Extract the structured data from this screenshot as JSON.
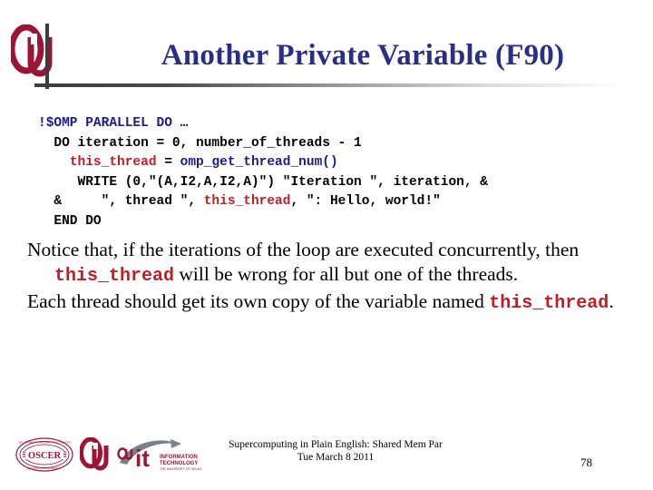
{
  "slide": {
    "title": "Another Private Variable (F90)",
    "title_color": "#2a2f86",
    "accent_crimson": "#9d1535",
    "code_blue": "#1b1b8f",
    "code_red": "#c21d24"
  },
  "header": {
    "logo_name": "ou-logo",
    "rule_name": "header-gradient-rule"
  },
  "code": {
    "lines": [
      {
        "name": "code-line-omp-directive",
        "segments": [
          {
            "text": "!$OMP PARALLEL DO ",
            "color": "blue"
          },
          {
            "text": "…",
            "color": "blue"
          }
        ]
      },
      {
        "name": "code-line-do-iteration",
        "segments": [
          {
            "text": "  DO iteration = 0, number_of_threads - 1",
            "color": "black"
          }
        ]
      },
      {
        "name": "code-line-assign-this-thread",
        "segments": [
          {
            "text": "    ",
            "color": "black"
          },
          {
            "text": "this_thread",
            "color": "red"
          },
          {
            "text": " = ",
            "color": "black"
          },
          {
            "text": "omp_get_thread_num()",
            "color": "blue"
          }
        ]
      },
      {
        "name": "code-line-write",
        "segments": [
          {
            "text": "     WRITE (0,\"(A,I2,A,I2,A)\") \"Iteration \", iteration, &",
            "color": "black"
          }
        ]
      },
      {
        "name": "code-line-write-continuation",
        "segments": [
          {
            "text": "  &     \", thread \", ",
            "color": "black"
          },
          {
            "text": "this_thread",
            "color": "red"
          },
          {
            "text": ", \": Hello, world!\"",
            "color": "black"
          }
        ]
      },
      {
        "name": "code-line-end-do",
        "segments": [
          {
            "text": "  END DO",
            "color": "black"
          }
        ]
      }
    ]
  },
  "body": {
    "paragraphs": [
      {
        "name": "body-paragraph-notice",
        "segments": [
          {
            "text": "Notice that, if the iterations of the loop are executed concurrently, then ",
            "style": "normal"
          },
          {
            "text": "this_thread",
            "style": "mono-red"
          },
          {
            "text": " will be wrong for all but one of the threads.",
            "style": "normal"
          }
        ]
      },
      {
        "name": "body-paragraph-each-thread",
        "segments": [
          {
            "text": "Each thread should get its own copy of the  variable named ",
            "style": "normal"
          },
          {
            "text": "this_thread",
            "style": "mono-red"
          },
          {
            "text": ".",
            "style": "normal"
          }
        ]
      }
    ]
  },
  "footer": {
    "line1": "Supercomputing in Plain English: Shared Mem Par",
    "line2": "Tue March 8 2011",
    "page_number": "78",
    "logos": [
      {
        "name": "oscer-logo",
        "label": "OSCER"
      },
      {
        "name": "ou-logo-footer",
        "label": "OU"
      },
      {
        "name": "ou-it-logo",
        "label": "it"
      }
    ],
    "it_logo_text": {
      "mark": "it",
      "line1": "INFORMATION",
      "line2": "TECHNOLOGY",
      "line3": "THE UNIVERSITY OF OKLAHOMA"
    },
    "oscer_logo_text": {
      "center": "OSCER",
      "ring_top": "OKLAHOMA SUPERCOMPUTING CENTER FOR",
      "ring_bottom": "EDUCATION & RESEARCH"
    }
  }
}
